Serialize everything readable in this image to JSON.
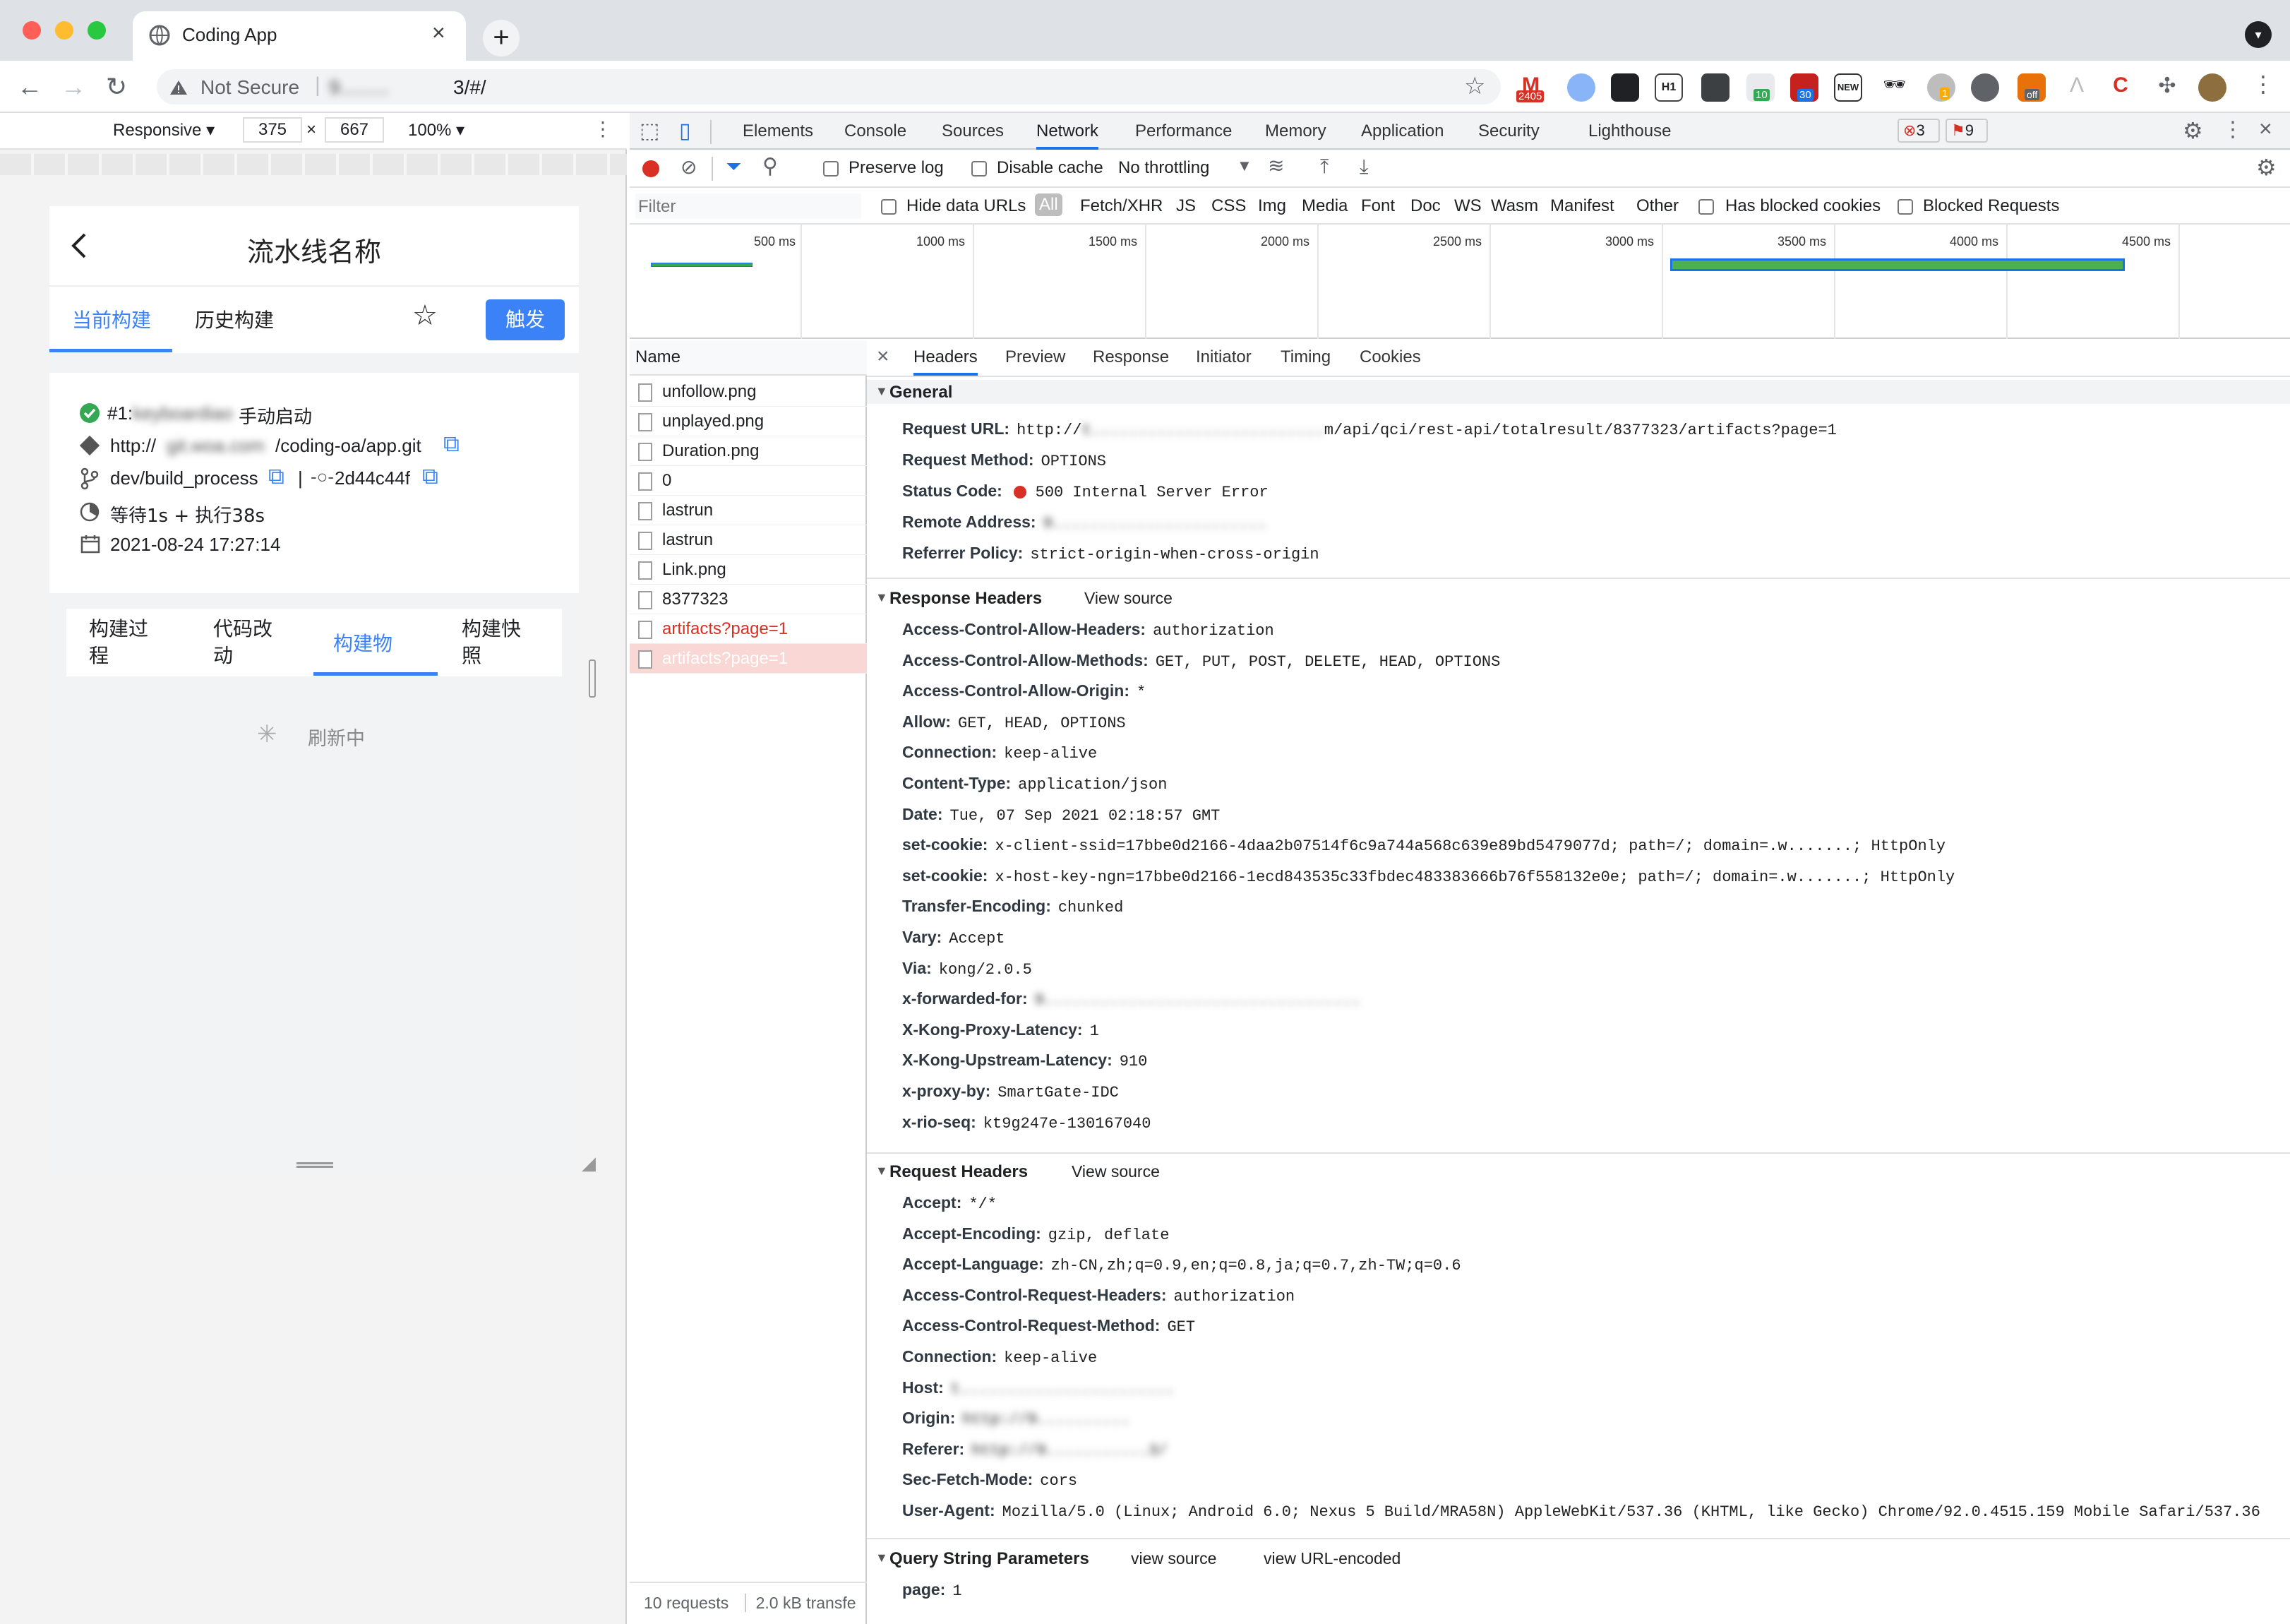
{
  "browser": {
    "tab_title": "Coding App",
    "security_label": "Not Secure",
    "url_blurred": "9.........",
    "url_suffix": "3/#/",
    "new_tab_glyph": "+",
    "badges": {
      "gmail": "2405",
      "ext_a": "10",
      "ext_b": "30",
      "ext_c": "1",
      "ext_off": "off",
      "new": "NEW",
      "h1": "H1"
    }
  },
  "device_toolbar": {
    "mode": "Responsive ▾",
    "width": "375",
    "times": "×",
    "height": "667",
    "zoom": "100% ▾"
  },
  "app": {
    "title": "流水线名称",
    "tabs": [
      "当前构建",
      "历史构建"
    ],
    "trigger_button": "触发",
    "build_id_prefix": "#1:",
    "build_user_blurred": "keyboardiao",
    "build_started": "手动启动",
    "repo_prefix": "http://",
    "repo_blurred": "git.woa.com",
    "repo_suffix": "/coding-oa/app.git",
    "branch": "dev/build_process",
    "divider": "|",
    "commit": "2d44c44f",
    "timing": "等待1s + 执行38s",
    "datetime": "2021-08-24 17:27:14",
    "sub_tabs": [
      "构建过程",
      "代码改动",
      "构建物",
      "构建快照"
    ],
    "loading_text": "刷新中"
  },
  "devtools": {
    "tabs": [
      "Elements",
      "Console",
      "Sources",
      "Network",
      "Performance",
      "Memory",
      "Application",
      "Security",
      "Lighthouse"
    ],
    "active_tab": "Network",
    "error_count": "3",
    "warning_count": "9",
    "preserve_log": "Preserve log",
    "disable_cache": "Disable cache",
    "throttling": "No throttling",
    "filter_placeholder": "Filter",
    "hide_data_urls": "Hide data URLs",
    "type_filters": [
      "All",
      "Fetch/XHR",
      "JS",
      "CSS",
      "Img",
      "Media",
      "Font",
      "Doc",
      "WS",
      "Wasm",
      "Manifest",
      "Other"
    ],
    "has_blocked_cookies": "Has blocked cookies",
    "blocked_requests": "Blocked Requests",
    "timeline_ticks": [
      "500 ms",
      "1000 ms",
      "1500 ms",
      "2000 ms",
      "2500 ms",
      "3000 ms",
      "3500 ms",
      "4000 ms",
      "4500 ms"
    ],
    "name_header": "Name",
    "requests": [
      "unfollow.png",
      "unplayed.png",
      "Duration.png",
      "0",
      "lastrun",
      "lastrun",
      "Link.png",
      "8377323",
      "artifacts?page=1",
      "artifacts?page=1"
    ],
    "status_requests": "10 requests",
    "status_transfer": "2.0 kB transfe",
    "detail_tabs": [
      "Headers",
      "Preview",
      "Response",
      "Initiator",
      "Timing",
      "Cookies"
    ],
    "close_glyph": "×",
    "general": {
      "title": "General",
      "request_url_key": "Request URL:",
      "request_url_prefix": "http://",
      "request_url_blurred": "t.........................",
      "request_url_suffix": "m/api/qci/rest-api/totalresult/8377323/artifacts?page=1",
      "method_key": "Request Method:",
      "method": "OPTIONS",
      "status_key": "Status Code:",
      "status": "500 Internal Server Error",
      "remote_key": "Remote Address:",
      "remote_blurred": "9.......................",
      "referrer_key": "Referrer Policy:",
      "referrer": "strict-origin-when-cross-origin"
    },
    "response_headers": {
      "title": "Response Headers",
      "view_source": "View source",
      "items": [
        {
          "k": "Access-Control-Allow-Headers:",
          "v": "authorization"
        },
        {
          "k": "Access-Control-Allow-Methods:",
          "v": "GET, PUT, POST, DELETE, HEAD, OPTIONS"
        },
        {
          "k": "Access-Control-Allow-Origin:",
          "v": "*"
        },
        {
          "k": "Allow:",
          "v": "GET, HEAD, OPTIONS"
        },
        {
          "k": "Connection:",
          "v": "keep-alive"
        },
        {
          "k": "Content-Type:",
          "v": "application/json"
        },
        {
          "k": "Date:",
          "v": "Tue, 07 Sep 2021 02:18:57 GMT"
        },
        {
          "k": "set-cookie:",
          "v": "x-client-ssid=17bbe0d2166-4daa2b07514f6c9a744a568c639e89bd5479077d; path=/; domain=.w.......; HttpOnly"
        },
        {
          "k": "set-cookie:",
          "v": "x-host-key-ngn=17bbe0d2166-1ecd843535c33fbdec483383666b76f558132e0e; path=/; domain=.w.......; HttpOnly"
        },
        {
          "k": "Transfer-Encoding:",
          "v": "chunked"
        },
        {
          "k": "Vary:",
          "v": "Accept"
        },
        {
          "k": "Via:",
          "v": "kong/2.0.5"
        },
        {
          "k": "x-forwarded-for:",
          "v": "9.................................."
        },
        {
          "k": "X-Kong-Proxy-Latency:",
          "v": "1"
        },
        {
          "k": "X-Kong-Upstream-Latency:",
          "v": "910"
        },
        {
          "k": "x-proxy-by:",
          "v": "SmartGate-IDC"
        },
        {
          "k": "x-rio-seq:",
          "v": "kt9g247e-130167040"
        }
      ]
    },
    "request_headers": {
      "title": "Request Headers",
      "view_source": "View source",
      "items": [
        {
          "k": "Accept:",
          "v": "*/*"
        },
        {
          "k": "Accept-Encoding:",
          "v": "gzip, deflate"
        },
        {
          "k": "Accept-Language:",
          "v": "zh-CN,zh;q=0.9,en;q=0.8,ja;q=0.7,zh-TW;q=0.6"
        },
        {
          "k": "Access-Control-Request-Headers:",
          "v": "authorization"
        },
        {
          "k": "Access-Control-Request-Method:",
          "v": "GET"
        },
        {
          "k": "Connection:",
          "v": "keep-alive"
        },
        {
          "k": "Host:",
          "v": "t......................."
        },
        {
          "k": "Origin:",
          "v": "http://9.........."
        },
        {
          "k": "Referer:",
          "v": "http://9...........3/"
        },
        {
          "k": "Sec-Fetch-Mode:",
          "v": "cors"
        },
        {
          "k": "User-Agent:",
          "v": "Mozilla/5.0 (Linux; Android 6.0; Nexus 5 Build/MRA58N) AppleWebKit/537.36 (KHTML, like Gecko) Chrome/92.0.4515.159 Mobile Safari/537.36"
        }
      ]
    },
    "query_params": {
      "title": "Query String Parameters",
      "view_source": "view source",
      "view_url_encoded": "view URL-encoded",
      "items": [
        {
          "k": "page:",
          "v": "1"
        }
      ]
    }
  },
  "colors": {
    "accent": "#1a73e8",
    "app_blue": "#3b82f6",
    "error_red": "#d93025",
    "success_green": "#34a853"
  }
}
